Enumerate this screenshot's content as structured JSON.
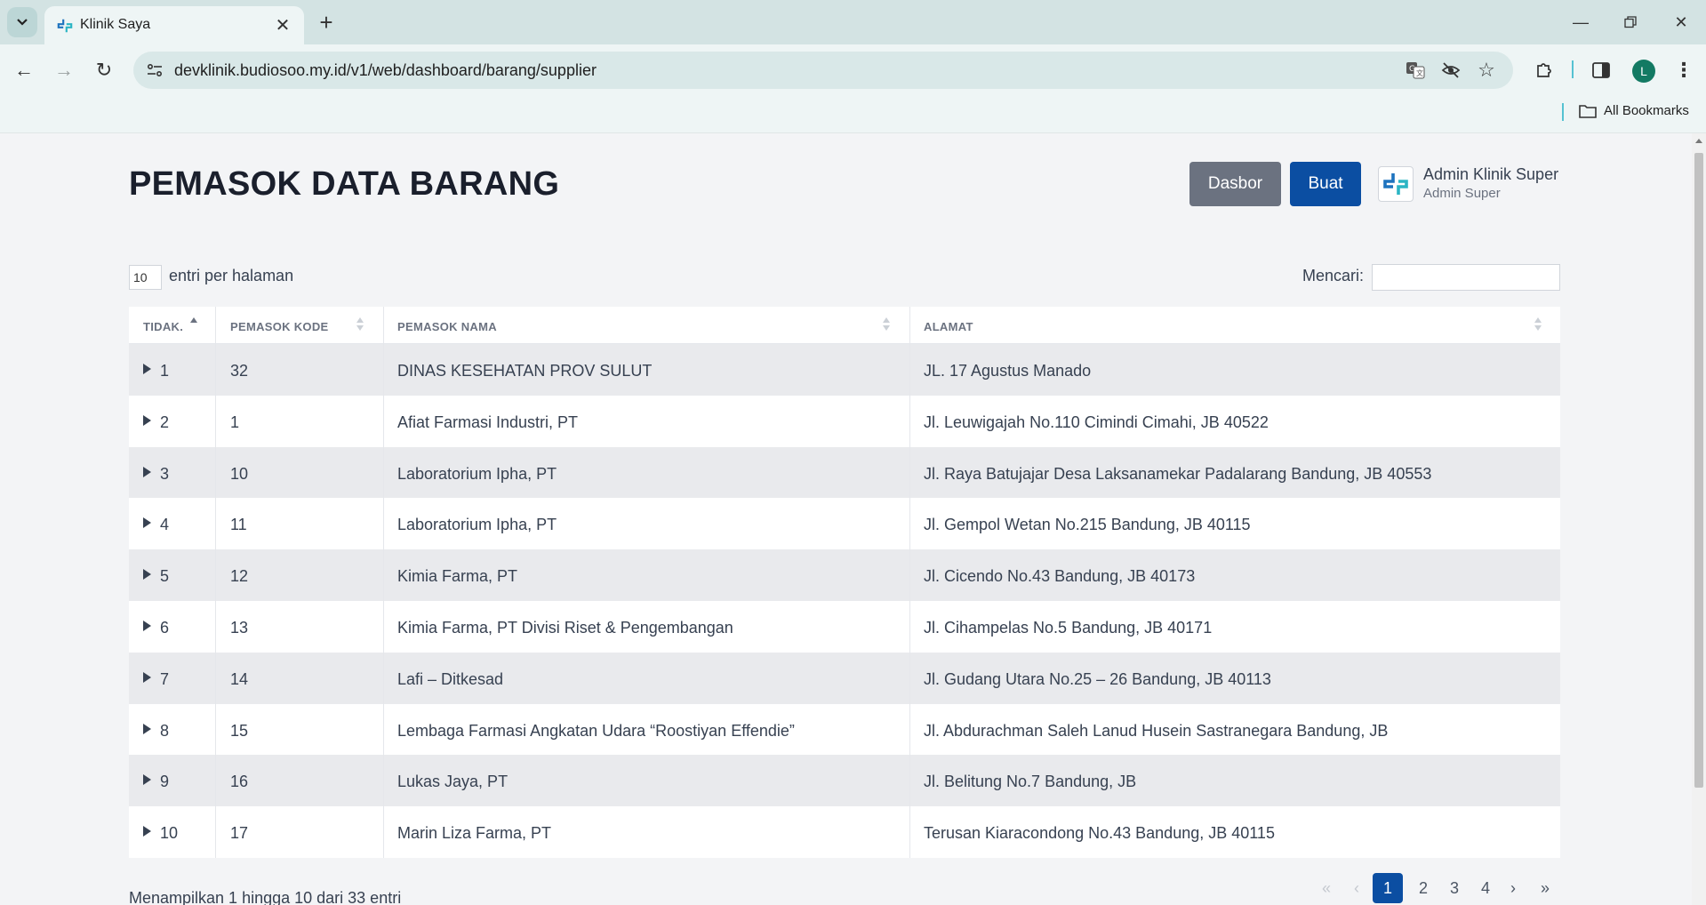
{
  "browser": {
    "tab_title": "Klinik Saya",
    "url": "devklinik.budiosoo.my.id/v1/web/dashboard/barang/supplier",
    "all_bookmarks": "All Bookmarks",
    "profile_initial": "L"
  },
  "header": {
    "title": "PEMASOK DATA BARANG",
    "btn_dasbor": "Dasbor",
    "btn_buat": "Buat",
    "user_name": "Admin Klinik Super",
    "user_role": "Admin Super"
  },
  "controls": {
    "page_length": "10",
    "length_label": "entri per halaman",
    "search_label": "Mencari:",
    "search_value": ""
  },
  "table": {
    "columns": [
      "TIDAK.",
      "PEMASOK KODE",
      "PEMASOK NAMA",
      "ALAMAT"
    ],
    "rows": [
      {
        "no": "1",
        "kode": "32",
        "nama": "DINAS KESEHATAN PROV SULUT",
        "alamat": "JL. 17 Agustus Manado"
      },
      {
        "no": "2",
        "kode": "1",
        "nama": "Afiat Farmasi Industri, PT",
        "alamat": "Jl. Leuwigajah No.110 Cimindi Cimahi, JB 40522"
      },
      {
        "no": "3",
        "kode": "10",
        "nama": "Laboratorium Ipha, PT",
        "alamat": "Jl. Raya Batujajar Desa Laksanamekar Padalarang Bandung, JB 40553"
      },
      {
        "no": "4",
        "kode": "11",
        "nama": "Laboratorium Ipha, PT",
        "alamat": "Jl. Gempol Wetan No.215 Bandung, JB 40115"
      },
      {
        "no": "5",
        "kode": "12",
        "nama": "Kimia Farma, PT",
        "alamat": "Jl. Cicendo No.43 Bandung, JB 40173"
      },
      {
        "no": "6",
        "kode": "13",
        "nama": "Kimia Farma, PT Divisi Riset & Pengembangan",
        "alamat": "Jl. Cihampelas No.5 Bandung, JB 40171"
      },
      {
        "no": "7",
        "kode": "14",
        "nama": "Lafi – Ditkesad",
        "alamat": "Jl. Gudang Utara No.25 – 26 Bandung, JB 40113"
      },
      {
        "no": "8",
        "kode": "15",
        "nama": "Lembaga Farmasi Angkatan Udara “Roostiyan Effendie”",
        "alamat": "Jl. Abdurachman Saleh Lanud Husein Sastranegara Bandung, JB"
      },
      {
        "no": "9",
        "kode": "16",
        "nama": "Lukas Jaya, PT",
        "alamat": "Jl. Belitung No.7 Bandung, JB"
      },
      {
        "no": "10",
        "kode": "17",
        "nama": "Marin Liza Farma, PT",
        "alamat": "Terusan Kiaracondong No.43 Bandung, JB 40115"
      }
    ]
  },
  "footer": {
    "info": "Menampilkan 1 hingga 10 dari 33 entri",
    "pager": {
      "first": "«",
      "prev": "‹",
      "pages": [
        "1",
        "2",
        "3",
        "4"
      ],
      "active_page": "1",
      "next": "›",
      "last": "»"
    }
  },
  "colors": {
    "primary": "#0b4ea2",
    "secondary": "#6b7280",
    "row_stripe": "#e9eaed",
    "chrome": "#d3e3e3"
  }
}
